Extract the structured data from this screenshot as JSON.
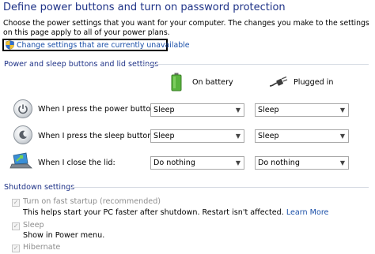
{
  "header": {
    "title": "Define power buttons and turn on password protection",
    "description": "Choose the power settings that you want for your computer. The changes you make to the settings on this page apply to all of your power plans."
  },
  "change_link": {
    "icon": "uac-shield-icon",
    "label": "Change settings that are currently unavailable"
  },
  "power_section": {
    "title": "Power and sleep buttons and lid settings",
    "columns": [
      {
        "label": "On battery",
        "icon": "battery-icon"
      },
      {
        "label": "Plugged in",
        "icon": "power-plug-icon"
      }
    ],
    "rows": [
      {
        "label": "When I press the power button:",
        "icon": "power-button-icon",
        "on_battery": "Sleep",
        "plugged_in": "Sleep"
      },
      {
        "label": "When I press the sleep button:",
        "icon": "sleep-button-icon",
        "on_battery": "Sleep",
        "plugged_in": "Sleep"
      },
      {
        "label": "When I close the lid:",
        "icon": "laptop-lid-icon",
        "on_battery": "Do nothing",
        "plugged_in": "Do nothing"
      }
    ]
  },
  "shutdown_section": {
    "title": "Shutdown settings",
    "items": [
      {
        "label": "Turn on fast startup (recommended)",
        "checked": true,
        "description": "This helps start your PC faster after shutdown. Restart isn't affected.",
        "link": "Learn More"
      },
      {
        "label": "Sleep",
        "checked": true,
        "description": "Show in Power menu."
      },
      {
        "label": "Hibernate",
        "checked": true
      }
    ]
  },
  "colors": {
    "title": "#1e3287",
    "link": "#1a4fa8",
    "disabled_text": "#8d8d8d",
    "battery_green": "#58b33d"
  }
}
